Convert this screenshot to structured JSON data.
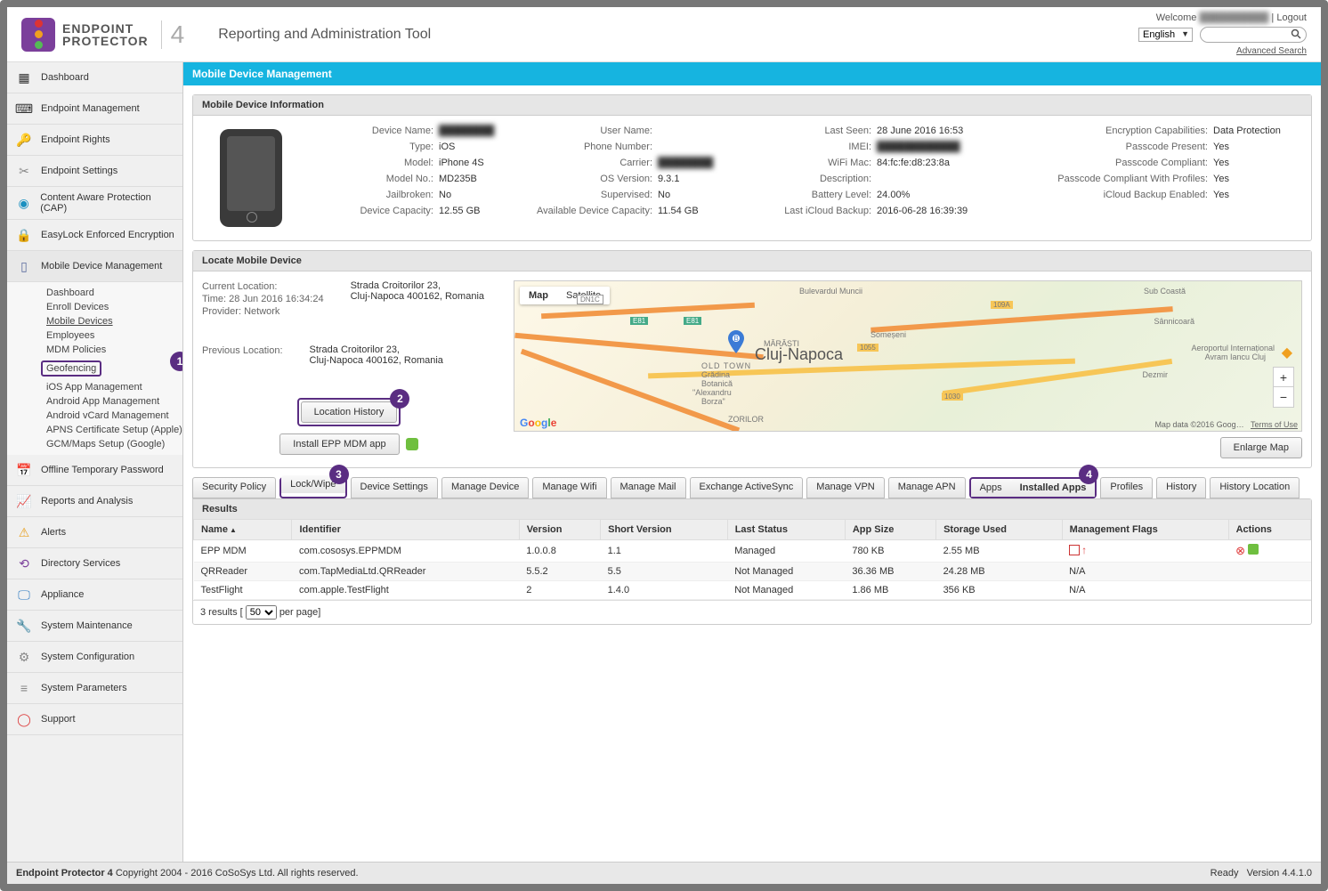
{
  "header": {
    "product_top": "ENDPOINT",
    "product_bottom": "PROTECTOR",
    "version": "4",
    "tagline": "Reporting and Administration Tool",
    "welcome": "Welcome",
    "user_name": "██████████",
    "logout": "Logout",
    "language": "English",
    "advanced_search": "Advanced Search"
  },
  "nav": {
    "items": [
      "Dashboard",
      "Endpoint Management",
      "Endpoint Rights",
      "Endpoint Settings",
      "Content Aware Protection (CAP)",
      "EasyLock Enforced Encryption",
      "Mobile Device Management",
      "Offline Temporary Password",
      "Reports and Analysis",
      "Alerts",
      "Directory Services",
      "Appliance",
      "System Maintenance",
      "System Configuration",
      "System Parameters",
      "Support"
    ],
    "sub": [
      "Dashboard",
      "Enroll Devices",
      "Mobile Devices",
      "Employees",
      "MDM Policies",
      "Geofencing",
      "iOS App Management",
      "Android App Management",
      "Android vCard Management",
      "APNS Certificate Setup (Apple)",
      "GCM/Maps Setup (Google)"
    ]
  },
  "page_title": "Mobile Device Management",
  "panels": {
    "device_info": "Mobile Device Information",
    "locate": "Locate Mobile Device",
    "results": "Results"
  },
  "device": {
    "labels": {
      "device_name": "Device Name:",
      "type": "Type:",
      "model": "Model:",
      "model_no": "Model No.:",
      "jailbroken": "Jailbroken:",
      "capacity": "Device Capacity:",
      "user_name": "User Name:",
      "phone": "Phone Number:",
      "carrier": "Carrier:",
      "os": "OS Version:",
      "supervised": "Supervised:",
      "avail": "Available Device Capacity:",
      "last_seen": "Last Seen:",
      "imei": "IMEI:",
      "wifi": "WiFi Mac:",
      "desc": "Description:",
      "battery": "Battery Level:",
      "icloud": "Last iCloud Backup:",
      "enc": "Encryption Capabilities:",
      "pc_present": "Passcode Present:",
      "pc_comp": "Passcode Compliant:",
      "pc_comp_prof": "Passcode Compliant With Profiles:",
      "icloud_en": "iCloud Backup Enabled:"
    },
    "values": {
      "device_name": "████████",
      "type": "iOS",
      "model": "iPhone 4S",
      "model_no": "MD235B",
      "jailbroken": "No",
      "capacity": "12.55 GB",
      "user_name": "",
      "phone": "",
      "carrier": "████████",
      "os": "9.3.1",
      "supervised": "No",
      "avail": "11.54 GB",
      "last_seen": "28 June 2016 16:53",
      "imei": "████████████",
      "wifi": "84:fc:fe:d8:23:8a",
      "desc": "",
      "battery": "24.00%",
      "icloud": "2016-06-28 16:39:39",
      "enc": "Data Protection",
      "pc_present": "Yes",
      "pc_comp": "Yes",
      "pc_comp_prof": "Yes",
      "icloud_en": "Yes"
    }
  },
  "locate": {
    "current_label": "Current Location:",
    "time_label": "Time: 28 Jun 2016 16:34:24",
    "provider_label": "Provider: Network",
    "prev_label": "Previous Location:",
    "address_line1": "Strada Croitorilor 23,",
    "address_line2": "Cluj-Napoca 400162, Romania",
    "btn_history": "Location History",
    "btn_install": "Install EPP MDM app",
    "map_tab_map": "Map",
    "map_tab_sat": "Satellite",
    "city": "Cluj-Napoca",
    "map_data": "Map data ©2016 Goog…",
    "terms": "Terms of Use",
    "enlarge": "Enlarge Map"
  },
  "tabs": [
    "Security Policy",
    "Lock/Wipe",
    "Device Settings",
    "Manage Device",
    "Manage Wifi",
    "Manage Mail",
    "Exchange ActiveSync",
    "Manage VPN",
    "Manage APN",
    "Apps",
    "Installed Apps",
    "Profiles",
    "History",
    "History Location"
  ],
  "table": {
    "cols": [
      "Name",
      "Identifier",
      "Version",
      "Short Version",
      "Last Status",
      "App Size",
      "Storage Used",
      "Management Flags",
      "Actions"
    ],
    "rows": [
      {
        "name": "EPP MDM",
        "id": "com.cososys.EPPMDM",
        "ver": "1.0.0.8",
        "sv": "1.1",
        "status": "Managed",
        "size": "780 KB",
        "storage": "2.55 MB",
        "flags": "icons",
        "actions": "icons"
      },
      {
        "name": "QRReader",
        "id": "com.TapMediaLtd.QRReader",
        "ver": "5.5.2",
        "sv": "5.5",
        "status": "Not Managed",
        "size": "36.36 MB",
        "storage": "24.28 MB",
        "flags": "N/A",
        "actions": ""
      },
      {
        "name": "TestFlight",
        "id": "com.apple.TestFlight",
        "ver": "2",
        "sv": "1.4.0",
        "status": "Not Managed",
        "size": "1.86 MB",
        "storage": "356 KB",
        "flags": "N/A",
        "actions": ""
      }
    ],
    "pager_pre": "3 results  [",
    "pager_count": "50",
    "pager_post": " per page]"
  },
  "footer": {
    "left_bold": "Endpoint Protector 4",
    "left_rest": " Copyright 2004 - 2016 CoSoSys Ltd. All rights reserved.",
    "ready": "Ready",
    "version": "Version 4.4.1.0"
  },
  "callouts": {
    "c1": "1",
    "c2": "2",
    "c3": "3",
    "c4": "4"
  },
  "map_labels": {
    "bulevardul": "Bulevardul Muncii",
    "subcoasta": "Sub Coastă",
    "sannicoara": "Sânnicoară",
    "someseni": "Someșeni",
    "marasti": "MĂRĂȘTI",
    "dezmir": "Dezmir",
    "airport1": "Aeroportul Internațional",
    "airport2": "Avram Iancu Cluj",
    "gradina1": "Grădina",
    "gradina2": "Botanică",
    "gradina3": "\"Alexandru",
    "gradina4": "Borza\"",
    "zorilor": "ZORILOR",
    "oldtown": "OLD TOWN",
    "dn1c": "DN1C",
    "e81": "E81",
    "r109a": "109A",
    "r1055": "1055",
    "r1030": "1030"
  }
}
